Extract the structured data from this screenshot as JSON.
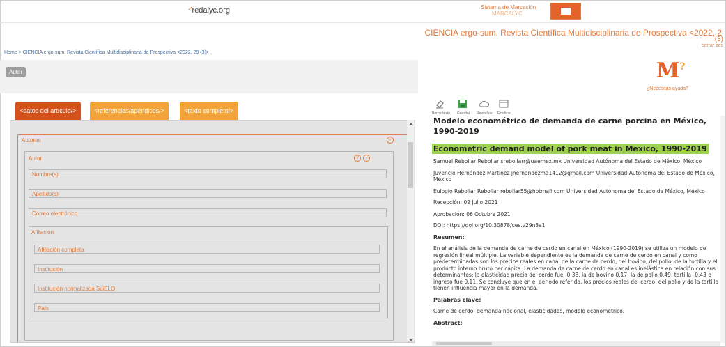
{
  "header": {
    "logo_left": "redalyc.org",
    "logo_right_line1": "Sistema de Marcación",
    "logo_right_line2": "MARCALYC",
    "journal_title": "CIENCIA ergo-sum, Revista Científica Multidisciplinaria de Prospectiva <2022, 2",
    "issue_suffix": "(3)",
    "close_label": "cerrar ses"
  },
  "breadcrumb": "Home > CIENCIA ergo-sum, Revista Científica Multidisciplinaria de Prospectiva <2022, 29 (3)>",
  "autor_button": "Autor",
  "help_label": "¿Necesitas ayuda?",
  "tabs": [
    {
      "label": "<datos del artículo/>"
    },
    {
      "label": "<referencias/apéndices/>"
    },
    {
      "label": "<texto completo/>"
    }
  ],
  "form": {
    "autores_label": "Autores",
    "autor_label": "Autor",
    "fields": [
      {
        "placeholder": "Nombre(s)"
      },
      {
        "placeholder": "Apellido(s)"
      },
      {
        "placeholder": "Correo electrónico"
      }
    ],
    "afiliacion_label": "Afiliación",
    "afiliacion_fields": [
      {
        "placeholder": "Afiliación completa"
      },
      {
        "placeholder": "Institución"
      },
      {
        "placeholder": "Institución normalizada SciELO"
      },
      {
        "placeholder": "País"
      }
    ]
  },
  "toolbar": {
    "items": [
      {
        "label": "Borrar texto",
        "icon": "eraser-icon"
      },
      {
        "label": "Guardar",
        "icon": "save-icon"
      },
      {
        "label": "Reevaluar",
        "icon": "cloud-icon"
      },
      {
        "label": "Finalizar",
        "icon": "window-icon"
      }
    ]
  },
  "article": {
    "title_es": "Modelo econométrico de demanda de carne porcina en México, 1990-2019",
    "title_en": "Econometric demand model of pork meat in Mexico, 1990-2019",
    "authors": [
      "Samuel Rebollar Rebollar srebollarr@uaemex.mx Universidad Autónoma del Estado de México, México",
      "Juvencio Hernández Martínez jhernandezma1412@gmail.com Universidad Autónoma del Estado de México, México",
      "Eulogio Rebollar Rebollar rebollar55@hotmail.com Universidad Autónoma del Estado de México, México"
    ],
    "received": "Recepción: 02 Julio 2021",
    "approved": "Aprobación: 06 Octubre 2021",
    "doi": "DOI: https://doi.org/10.30878/ces.v29n3a1",
    "resumen_heading": "Resumen:",
    "resumen": "En el análisis de la demanda de carne de cerdo en canal en México (1990-2019) se utiliza un modelo de regresión lineal múltiple. La variable dependiente es la demanda de carne de cerdo en canal y como predeterminadas son los precios reales en canal de la carne de cerdo, del bovino, del pollo, de la tortilla y el producto interno bruto per cápita. La demanda de carne de cerdo en canal es inelástica en relación con sus determinantes: la elasticidad precio del cerdo fue -0.38, la de bovino 0.17, la de pollo 0.49, tortilla -0.43 e ingreso fue 0.11. Se concluye que en el periodo referido, los precios reales del cerdo, del pollo y de la tortilla tienen influencia mayor en la demanda.",
    "keywords_heading": "Palabras clave:",
    "keywords": "Carne de cerdo, demanda nacional, elasticidades, modelo econométrico.",
    "abstract_heading": "Abstract:"
  }
}
